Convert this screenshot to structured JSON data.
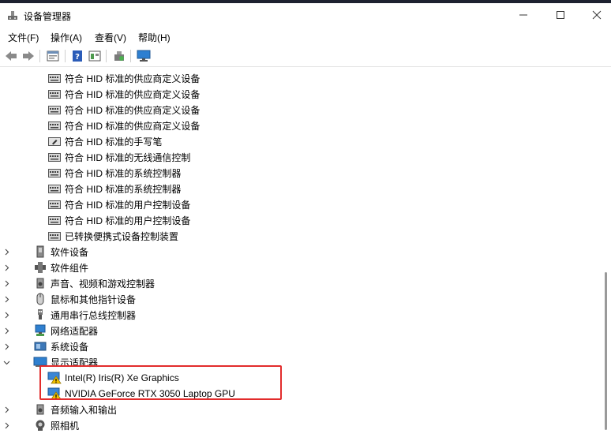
{
  "window": {
    "title": "设备管理器"
  },
  "menu": [
    {
      "label": "文件(F)"
    },
    {
      "label": "操作(A)"
    },
    {
      "label": "查看(V)"
    },
    {
      "label": "帮助(H)"
    }
  ],
  "toolbar": {
    "buttons": [
      "back-icon",
      "forward-icon",
      "properties-icon",
      "help-icon",
      "show-hidden-icon",
      "update-driver-icon",
      "monitor-icon"
    ]
  },
  "tree": {
    "hid_children": [
      {
        "label": "符合 HID 标准的供应商定义设备",
        "icon": "hid-device-icon"
      },
      {
        "label": "符合 HID 标准的供应商定义设备",
        "icon": "hid-device-icon"
      },
      {
        "label": "符合 HID 标准的供应商定义设备",
        "icon": "hid-device-icon"
      },
      {
        "label": "符合 HID 标准的供应商定义设备",
        "icon": "hid-device-icon"
      },
      {
        "label": "符合 HID 标准的手写笔",
        "icon": "pen-device-icon"
      },
      {
        "label": "符合 HID 标准的无线通信控制",
        "icon": "hid-device-icon"
      },
      {
        "label": "符合 HID 标准的系统控制器",
        "icon": "hid-device-icon"
      },
      {
        "label": "符合 HID 标准的系统控制器",
        "icon": "hid-device-icon"
      },
      {
        "label": "符合 HID 标准的用户控制设备",
        "icon": "hid-device-icon"
      },
      {
        "label": "符合 HID 标准的用户控制设备",
        "icon": "hid-device-icon"
      },
      {
        "label": "已转换便携式设备控制装置",
        "icon": "hid-device-icon"
      }
    ],
    "categories_before": [
      {
        "label": "软件设备",
        "icon": "software-device-icon"
      },
      {
        "label": "软件组件",
        "icon": "software-component-icon"
      },
      {
        "label": "声音、视频和游戏控制器",
        "icon": "speaker-icon"
      },
      {
        "label": "鼠标和其他指针设备",
        "icon": "mouse-icon"
      },
      {
        "label": "通用串行总线控制器",
        "icon": "usb-icon"
      },
      {
        "label": "网络适配器",
        "icon": "network-icon"
      },
      {
        "label": "系统设备",
        "icon": "system-device-icon"
      }
    ],
    "display_adapters": {
      "label": "显示适配器",
      "icon": "display-adapter-icon",
      "children": [
        {
          "label": "Intel(R) Iris(R) Xe Graphics",
          "icon": "warning-icon"
        },
        {
          "label": "NVIDIA GeForce RTX 3050 Laptop GPU",
          "icon": "warning-icon"
        }
      ]
    },
    "categories_after": [
      {
        "label": "音频输入和输出",
        "icon": "audio-io-icon"
      },
      {
        "label": "照相机",
        "icon": "camera-icon"
      }
    ]
  },
  "colors": {
    "highlight_border": "#e22c2c",
    "warning_yellow": "#f2c200"
  }
}
